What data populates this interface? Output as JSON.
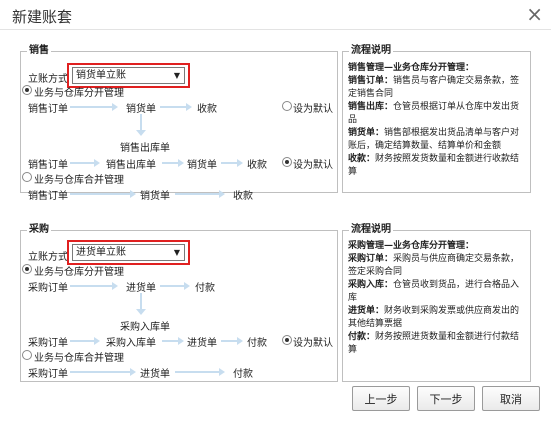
{
  "window": {
    "title": "新建账套",
    "close_label": "×"
  },
  "sales": {
    "group_title": "销售",
    "mode_label": "立账方式",
    "mode_value": "销货单立账",
    "option_separate": "业务与仓库分开管理",
    "option_combined": "业务与仓库合并管理",
    "set_default": "设为默认",
    "flow1": [
      "销售订单",
      "销货单",
      "收款"
    ],
    "flow2_top": "销售出库单",
    "flow2": [
      "销售订单",
      "销售出库单",
      "销货单",
      "收款"
    ],
    "flow3": [
      "销售订单",
      "销货单",
      "收款"
    ]
  },
  "sales_desc": {
    "title": "流程说明",
    "heading": "销售管理—业务仓库分开管理：",
    "items": [
      {
        "term": "销售订单：",
        "text": "销售员与客户确定交易条款，签定销售合同"
      },
      {
        "term": "销售出库：",
        "text": "仓管员根据订单从仓库中发出货品"
      },
      {
        "term": "销货单：",
        "text": "销售部根据发出货品清单与客户对账后，确定结算数量、结算单价和金额"
      },
      {
        "term": "收款：",
        "text": "财务按照发货数量和金额进行收款结算"
      }
    ]
  },
  "purchase": {
    "group_title": "采购",
    "mode_label": "立账方式",
    "mode_value": "进货单立账",
    "option_separate": "业务与仓库分开管理",
    "option_combined": "业务与仓库合并管理",
    "set_default": "设为默认",
    "flow1": [
      "采购订单",
      "进货单",
      "付款"
    ],
    "flow2_top": "采购入库单",
    "flow2": [
      "采购订单",
      "采购入库单",
      "进货单",
      "付款"
    ],
    "flow3": [
      "采购订单",
      "进货单",
      "付款"
    ]
  },
  "purchase_desc": {
    "title": "流程说明",
    "heading": "采购管理—业务仓库分开管理：",
    "items": [
      {
        "term": "采购订单：",
        "text": "采购员与供应商确定交易条款，签定采购合同"
      },
      {
        "term": "采购入库：",
        "text": "仓管员收到货品，进行合格品入库"
      },
      {
        "term": "进货单：",
        "text": "财务收到采购发票或供应商发出的其他结算票据"
      },
      {
        "term": "付款：",
        "text": "财务按照进货数量和金额进行付款结算"
      }
    ]
  },
  "buttons": {
    "prev": "上一步",
    "next": "下一步",
    "cancel": "取消"
  },
  "icons": {
    "dropdown": "triangle-down-icon",
    "arrow": "flow-arrow-icon"
  },
  "colors": {
    "highlight": "#e02020",
    "arrow": "#c7ddef"
  }
}
